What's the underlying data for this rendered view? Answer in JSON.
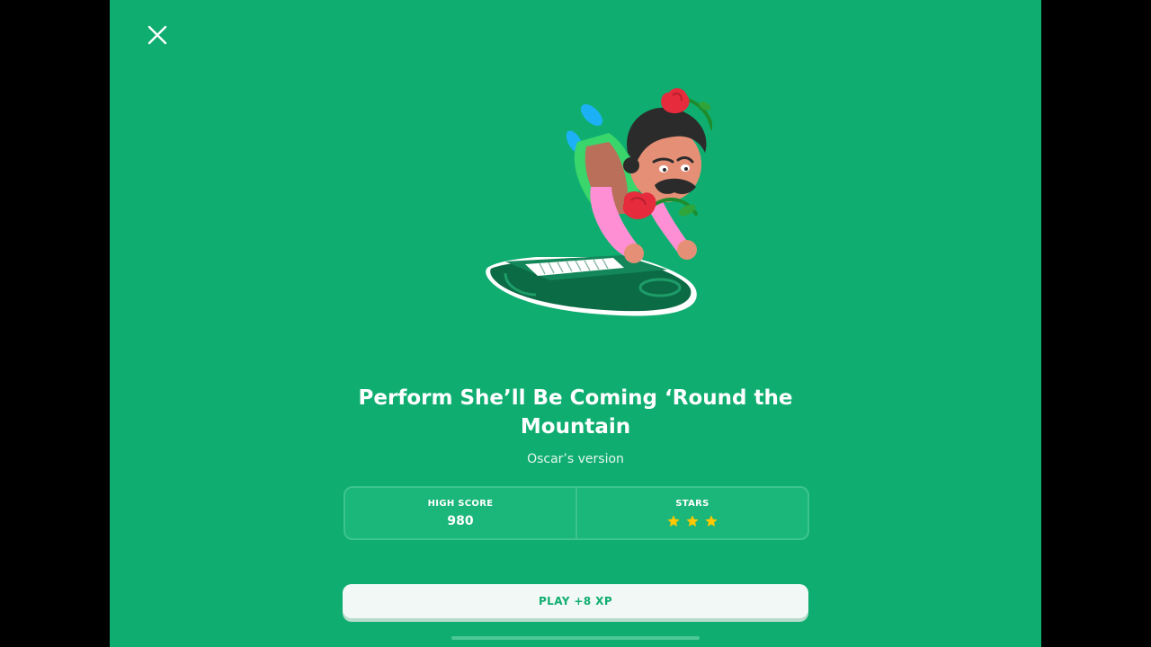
{
  "lesson": {
    "title": "Perform She’ll Be Coming ‘Round the Mountain",
    "subtitle": "Oscar’s version"
  },
  "stats": {
    "high_score_label": "HIGH SCORE",
    "high_score_value": "980",
    "stars_label": "STARS",
    "stars_earned": 3,
    "stars_total": 3
  },
  "actions": {
    "play_label": "PLAY +8 XP"
  },
  "icons": {
    "close": "close-icon",
    "star": "star-icon"
  },
  "colors": {
    "background": "#0FAE70",
    "star": "#FFC800",
    "button_text": "#0FAE70",
    "button_bg": "#F2F8F6"
  }
}
